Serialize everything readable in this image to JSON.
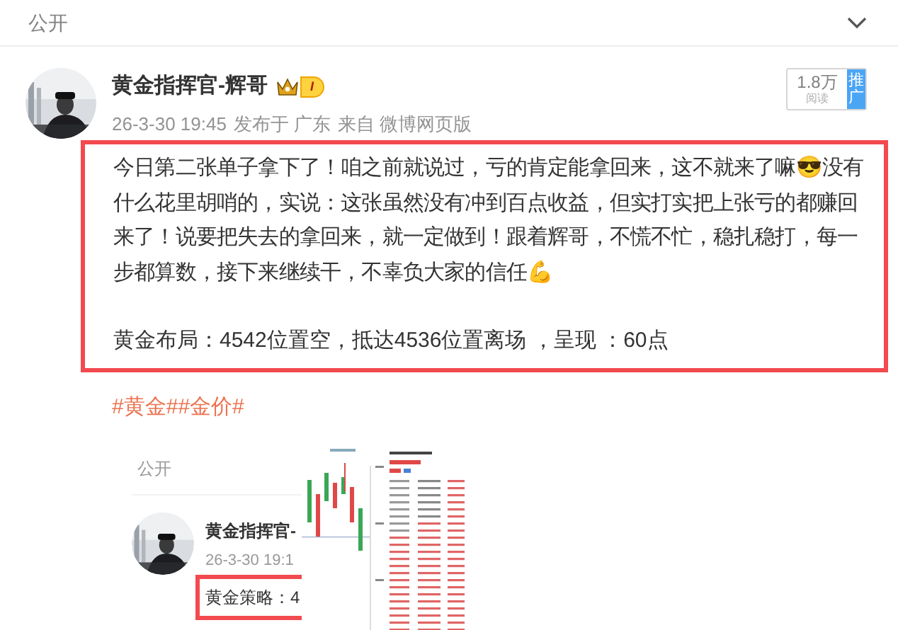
{
  "header": {
    "title": "公开",
    "expanded": false
  },
  "post": {
    "author": "黄金指挥官-辉哥",
    "vip_level": "I",
    "time": "26-3-30 19:45",
    "location": "发布于 广东",
    "source": "来自 微博网页版",
    "reads": {
      "count": "1.8万",
      "label": "阅读",
      "promote": "推广"
    },
    "body": "今日第二张单子拿下了！咱之前就说过，亏的肯定能拿回来，这不就来了嘛😎没有什么花里胡哨的，实说：这张虽然没有冲到百点收益，但实打实把上张亏的都赚回来了！说要把失去的拿回来，就一定做到！跟着辉哥，不慌不忙，稳扎稳打，每一步都算数，接下来继续干，不辜负大家的信任💪",
    "summary": "黄金布局：4542位置空，抵达4536位置离场 ，呈现 ：60点",
    "hashtags": [
      "#黄金#",
      "#金价#"
    ],
    "image": {
      "title": "公开",
      "author": "黄金指挥官-",
      "time": "26-3-30 19:1",
      "text": "黄金策略：4"
    }
  }
}
